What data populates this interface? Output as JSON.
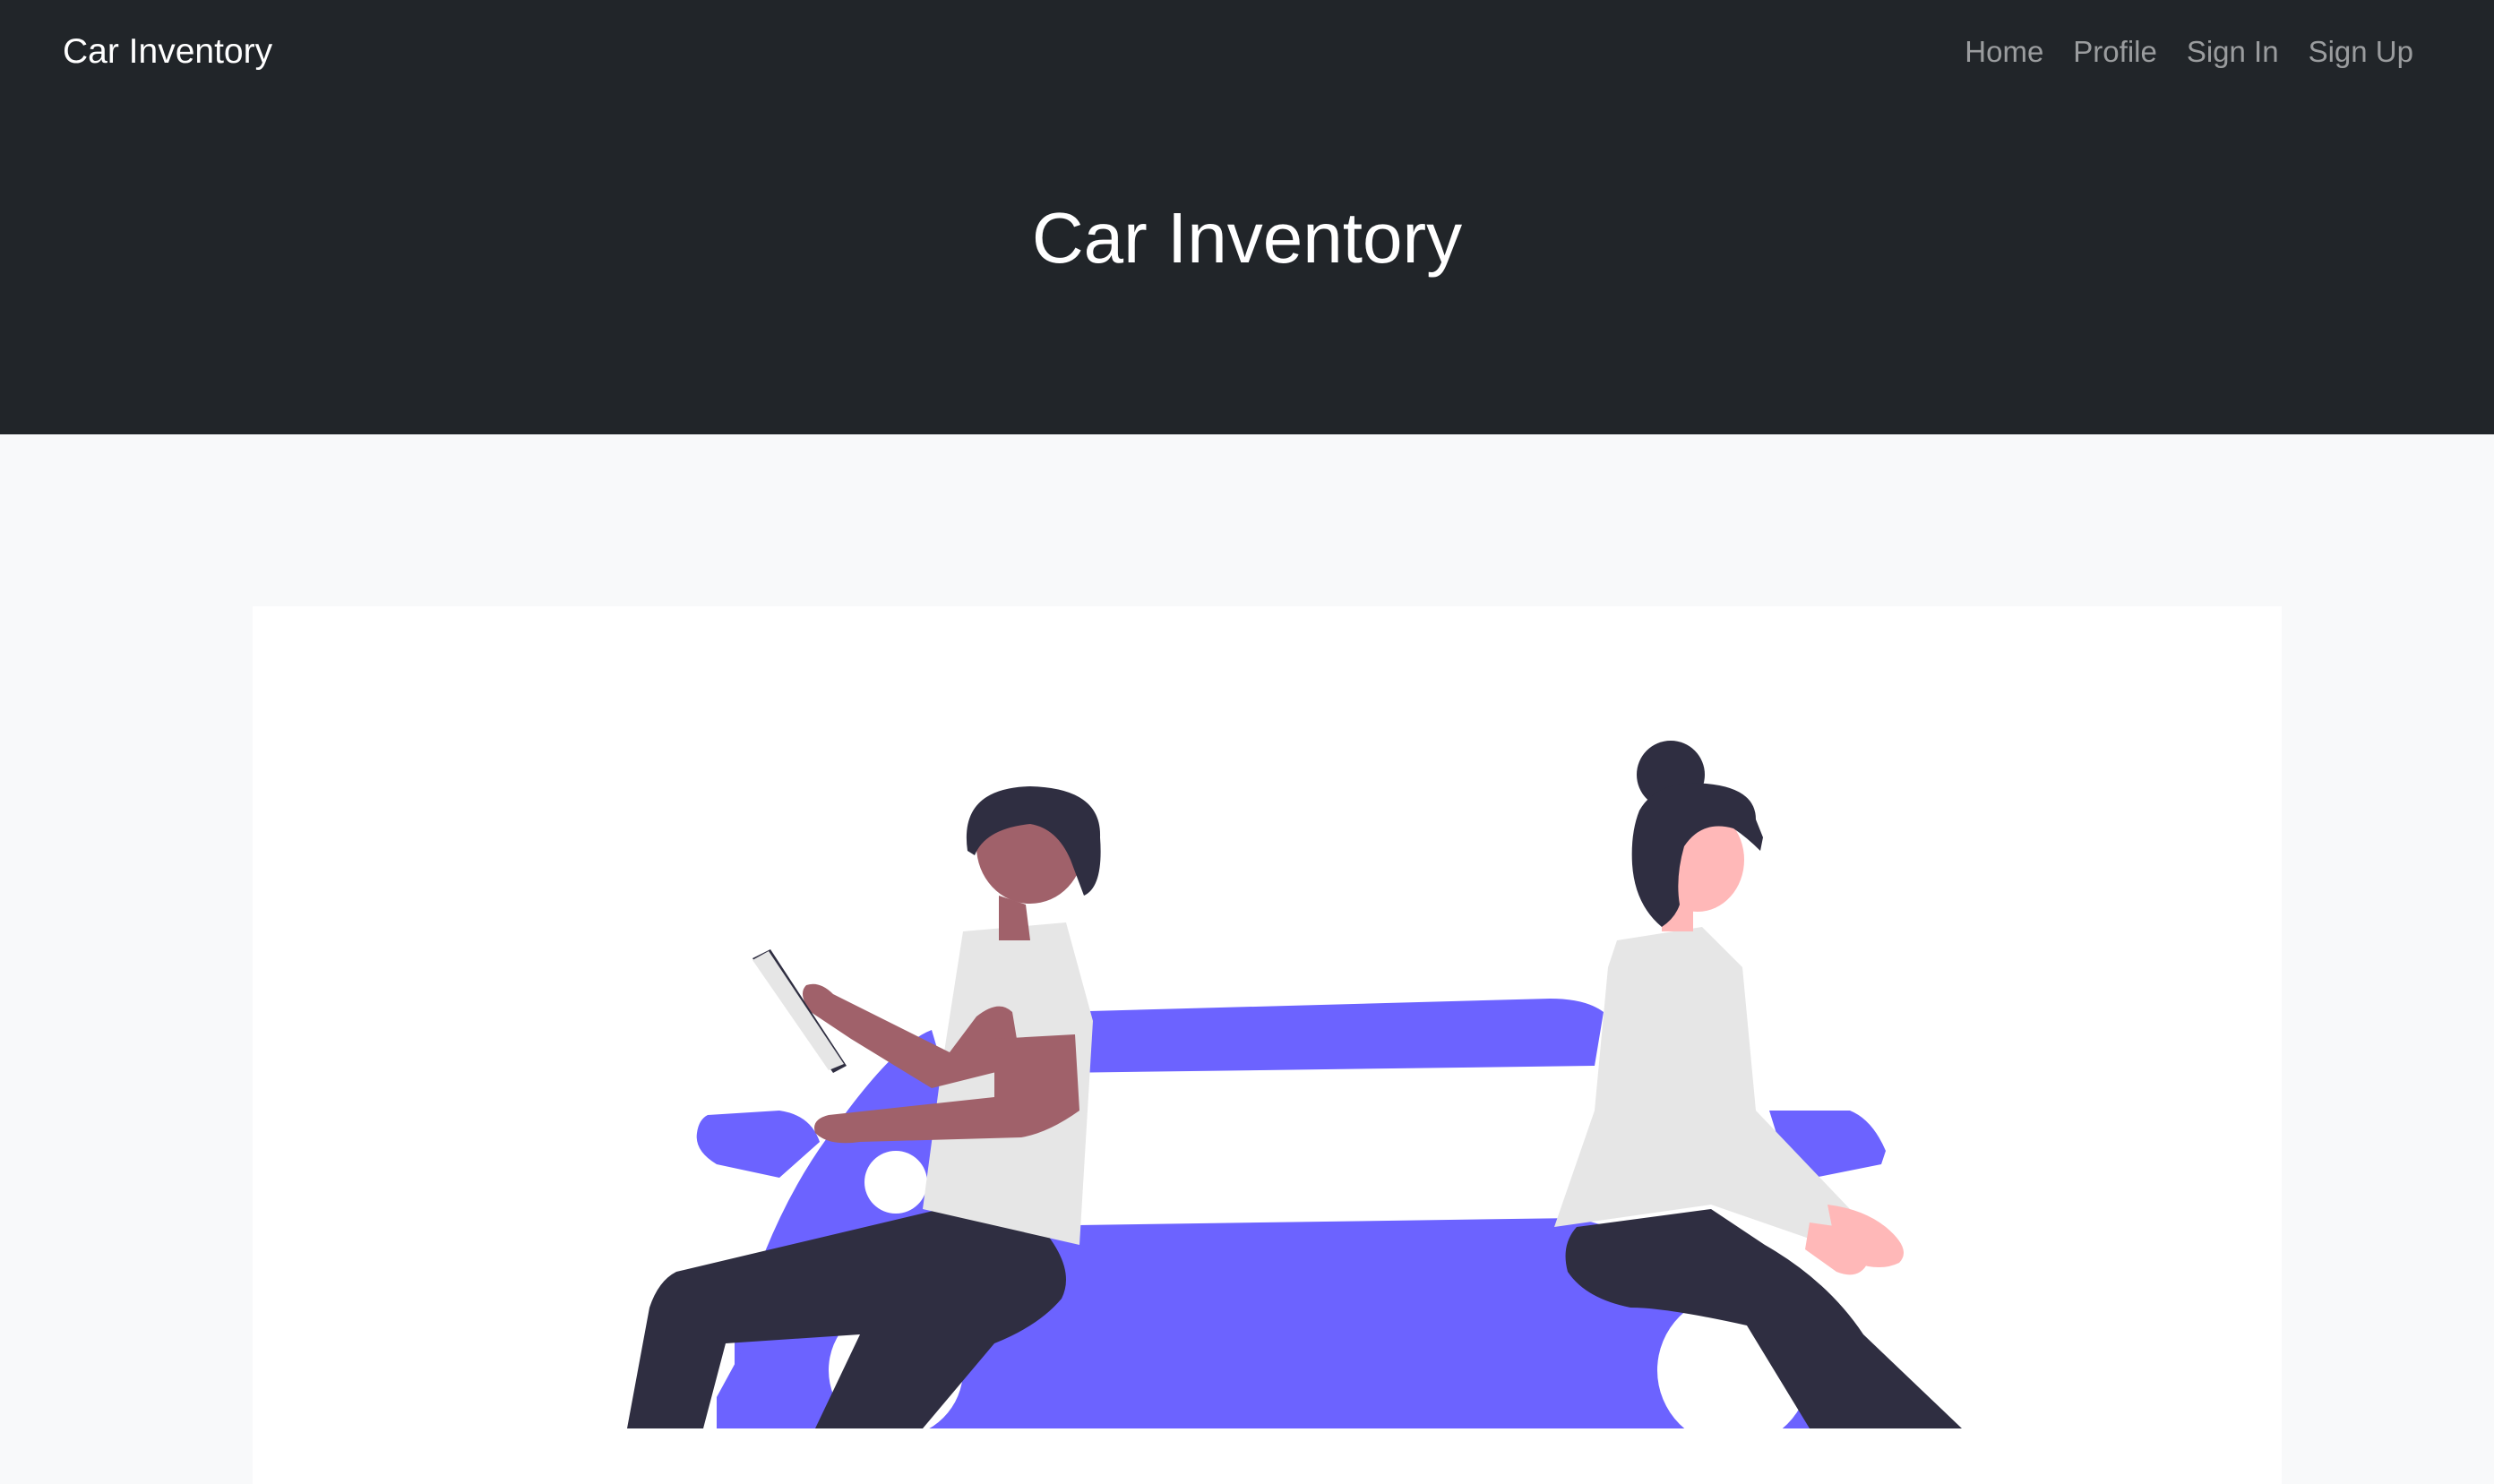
{
  "navbar": {
    "brand": "Car Inventory",
    "links": [
      {
        "label": "Home"
      },
      {
        "label": "Profile"
      },
      {
        "label": "Sign In"
      },
      {
        "label": "Sign Up"
      }
    ]
  },
  "hero": {
    "title": "Car Inventory"
  },
  "illustration": {
    "subject": "two people sitting back-to-back on a purple car",
    "colors": {
      "car": "#6c63ff",
      "dark": "#2f2e41",
      "shirt": "#e6e6e6",
      "skin_man": "#a0616a",
      "skin_woman": "#ffb8b8"
    }
  }
}
